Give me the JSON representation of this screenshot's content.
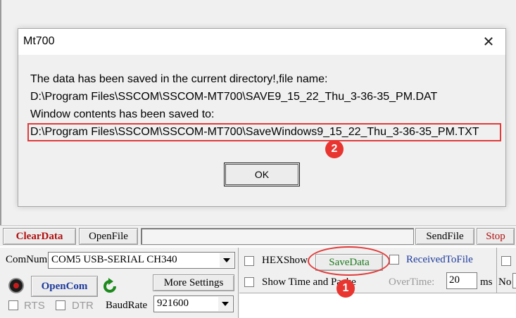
{
  "dialog": {
    "title": "Mt700",
    "close_glyph": "✕",
    "line1": "The data has been saved in the current directory!,file name:",
    "line2": "D:\\Program Files\\SSCOM\\SSCOM-MT700\\SAVE9_15_22_Thu_3-36-35_PM.DAT",
    "line3": "Window contents has been saved to:",
    "line4": "D:\\Program Files\\SSCOM\\SSCOM-MT700\\SaveWindows9_15_22_Thu_3-36-35_PM.TXT",
    "ok_label": "OK"
  },
  "toolbar": {
    "clear_data": "ClearData",
    "open_file": "OpenFile",
    "send_file": "SendFile",
    "stop": "Stop"
  },
  "settings": {
    "comnum_label": "ComNum",
    "comnum_value": "COM5 USB-SERIAL CH340",
    "open_com": "OpenCom",
    "more_settings": "More Settings",
    "rts_label": "RTS",
    "dtr_label": "DTR",
    "baudrate_label": "BaudRate",
    "baudrate_value": "921600",
    "hexshow_label": "HEXShow",
    "save_data": "SaveData",
    "received_to_file": "ReceivedToFile",
    "show_time": "Show Time and Packe",
    "overtime_label": "OverTime:",
    "overtime_value": "20",
    "ms_label": "ms",
    "no_label": "No"
  },
  "annotations": {
    "badge1": "1",
    "badge2": "2",
    "highlight_color": "#e23a3a"
  },
  "icons": {
    "close": "close-icon",
    "status_led": "record-dot-icon",
    "refresh": "refresh-icon",
    "dropdown": "chevron-down-icon"
  }
}
